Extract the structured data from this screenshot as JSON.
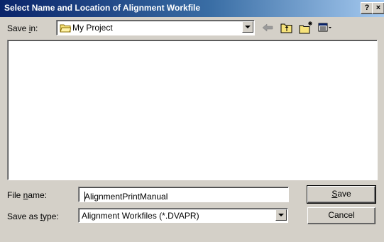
{
  "window": {
    "title": "Select Name and Location of Alignment Workfile",
    "help_button": "?",
    "close_button": "×"
  },
  "save_in": {
    "label_pre": "Save ",
    "label_accel": "i",
    "label_post": "n:",
    "value": "My Project",
    "icon": "folder-icon"
  },
  "toolbar": {
    "icons": [
      "back-arrow-icon",
      "up-folder-icon",
      "new-folder-icon",
      "view-menu-icon"
    ]
  },
  "file_list": {
    "items": []
  },
  "file_name": {
    "label_pre": "File ",
    "label_accel": "n",
    "label_post": "ame:",
    "value": "AlignmentPrintManual"
  },
  "save_as_type": {
    "label_pre": "Save as ",
    "label_accel": "t",
    "label_post": "ype:",
    "value": "Alignment Workfiles (*.DVAPR)"
  },
  "buttons": {
    "save_accel": "S",
    "save_rest": "ave",
    "cancel": "Cancel"
  }
}
